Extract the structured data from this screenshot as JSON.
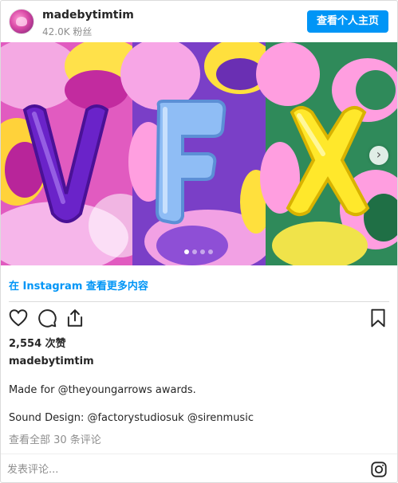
{
  "header": {
    "username": "madebytimtim",
    "followers": "42.0K 粉丝",
    "profile_button": "查看个人主页"
  },
  "media": {
    "alt_letters": "VFX",
    "slide_count": 4,
    "active_slide": 1,
    "next_icon": "chevron-right-icon"
  },
  "view_more_link": "在 Instagram 查看更多内容",
  "actions": {
    "like_icon": "heart-icon",
    "comment_icon": "comment-icon",
    "share_icon": "share-icon",
    "save_icon": "bookmark-icon"
  },
  "likes": "2,554 次赞",
  "owner": "madebytimtim",
  "caption": "Made for @theyoungarrows awards.",
  "sound_design": "Sound Design: @factorystudiosuk @sirenmusic",
  "view_comments": "查看全部 30 条评论",
  "comment_placeholder": "发表评论...",
  "colors": {
    "accent": "#0095f6",
    "text": "#262626",
    "muted": "#8e8e8e",
    "border": "#dbdbdb"
  }
}
